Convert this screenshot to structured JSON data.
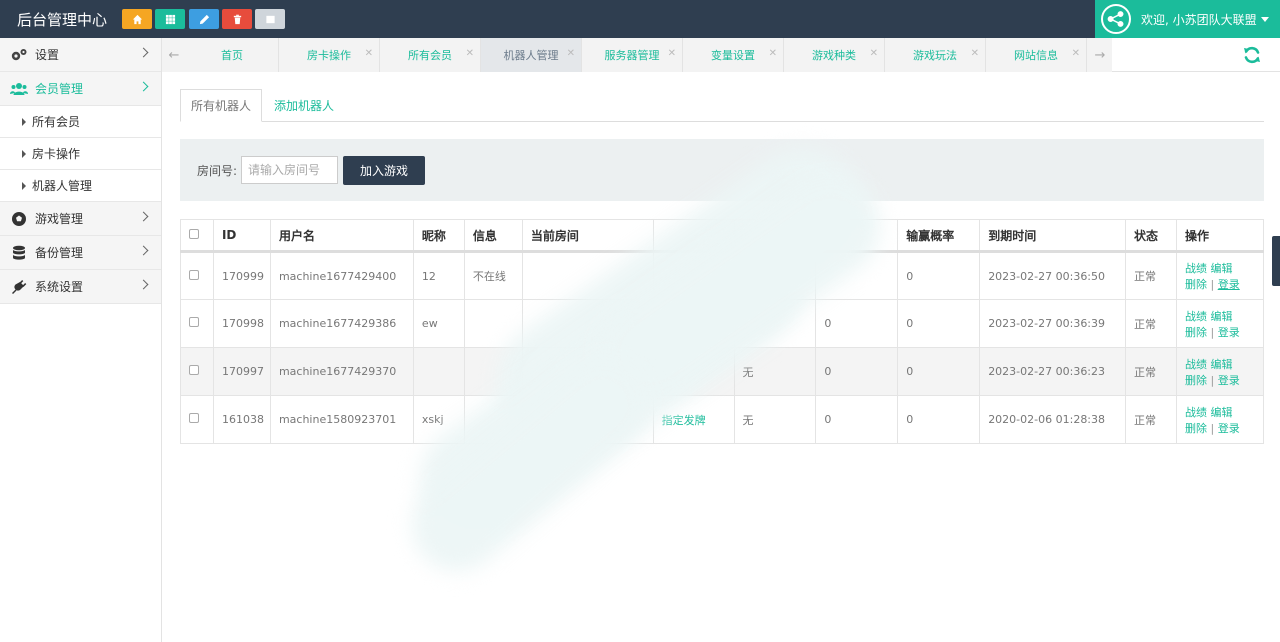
{
  "app": {
    "brand": "后台管理中心",
    "welcome": "欢迎, 小苏团队大联盟"
  },
  "quick_icons": [
    "home-icon",
    "grid-icon",
    "edit-icon",
    "trash-icon",
    "list-icon"
  ],
  "sidebar": {
    "items": [
      {
        "label": "设置",
        "icon": "gears-icon"
      },
      {
        "label": "会员管理",
        "icon": "users-icon",
        "active": true
      },
      {
        "label": "游戏管理",
        "icon": "soccer-ball-icon"
      },
      {
        "label": "备份管理",
        "icon": "database-icon"
      },
      {
        "label": "系统设置",
        "icon": "plug-icon"
      }
    ],
    "sub_items": [
      "所有会员",
      "房卡操作",
      "机器人管理"
    ]
  },
  "tabs": [
    {
      "label": "首页"
    },
    {
      "label": "房卡操作"
    },
    {
      "label": "所有会员"
    },
    {
      "label": "机器人管理",
      "active": true
    },
    {
      "label": "服务器管理"
    },
    {
      "label": "变量设置"
    },
    {
      "label": "游戏种类"
    },
    {
      "label": "游戏玩法"
    },
    {
      "label": "网站信息"
    }
  ],
  "subtabs": [
    "所有机器人",
    "添加机器人"
  ],
  "search": {
    "label": "房间号:",
    "placeholder": "请输入房间号",
    "button": "加入游戏"
  },
  "table": {
    "headers": [
      "ID",
      "用户名",
      "昵称",
      "信息",
      "当前房间",
      "",
      "",
      "",
      "输赢概率",
      "到期时间",
      "状态",
      "操作"
    ],
    "rows": [
      {
        "id": "170999",
        "username": "machine1677429400",
        "nickname": "12",
        "info": "不在线",
        "room": "",
        "c6": "",
        "c7": "",
        "c8": "",
        "rate": "0",
        "expire": "2023-02-27 00:36:50",
        "status": "正常"
      },
      {
        "id": "170998",
        "username": "machine1677429386",
        "nickname": "ew",
        "info": "",
        "room": "",
        "c6": "",
        "c7": "",
        "c8": "0",
        "rate": "0",
        "expire": "2023-02-27 00:36:39",
        "status": "正常"
      },
      {
        "id": "170997",
        "username": "machine1677429370",
        "nickname": "",
        "info": "",
        "room": "",
        "c6": "",
        "c7": "无",
        "c8": "0",
        "rate": "0",
        "expire": "2023-02-27 00:36:23",
        "status": "正常"
      },
      {
        "id": "161038",
        "username": "machine1580923701",
        "nickname": "xskj",
        "info": "",
        "room": "",
        "c6": "指定发牌",
        "c7": "无",
        "c8": "0",
        "rate": "0",
        "expire": "2020-02-06 01:28:38",
        "status": "正常"
      }
    ],
    "ops": {
      "record": "战绩",
      "edit": "编辑",
      "delete": "删除",
      "login": "登录",
      "sep": "|"
    }
  },
  "colors": {
    "topbar": "#2f3e50",
    "accent": "#1bbc9b",
    "orange": "#f5a623",
    "blue": "#3d9ee1",
    "red": "#e74c3c"
  }
}
